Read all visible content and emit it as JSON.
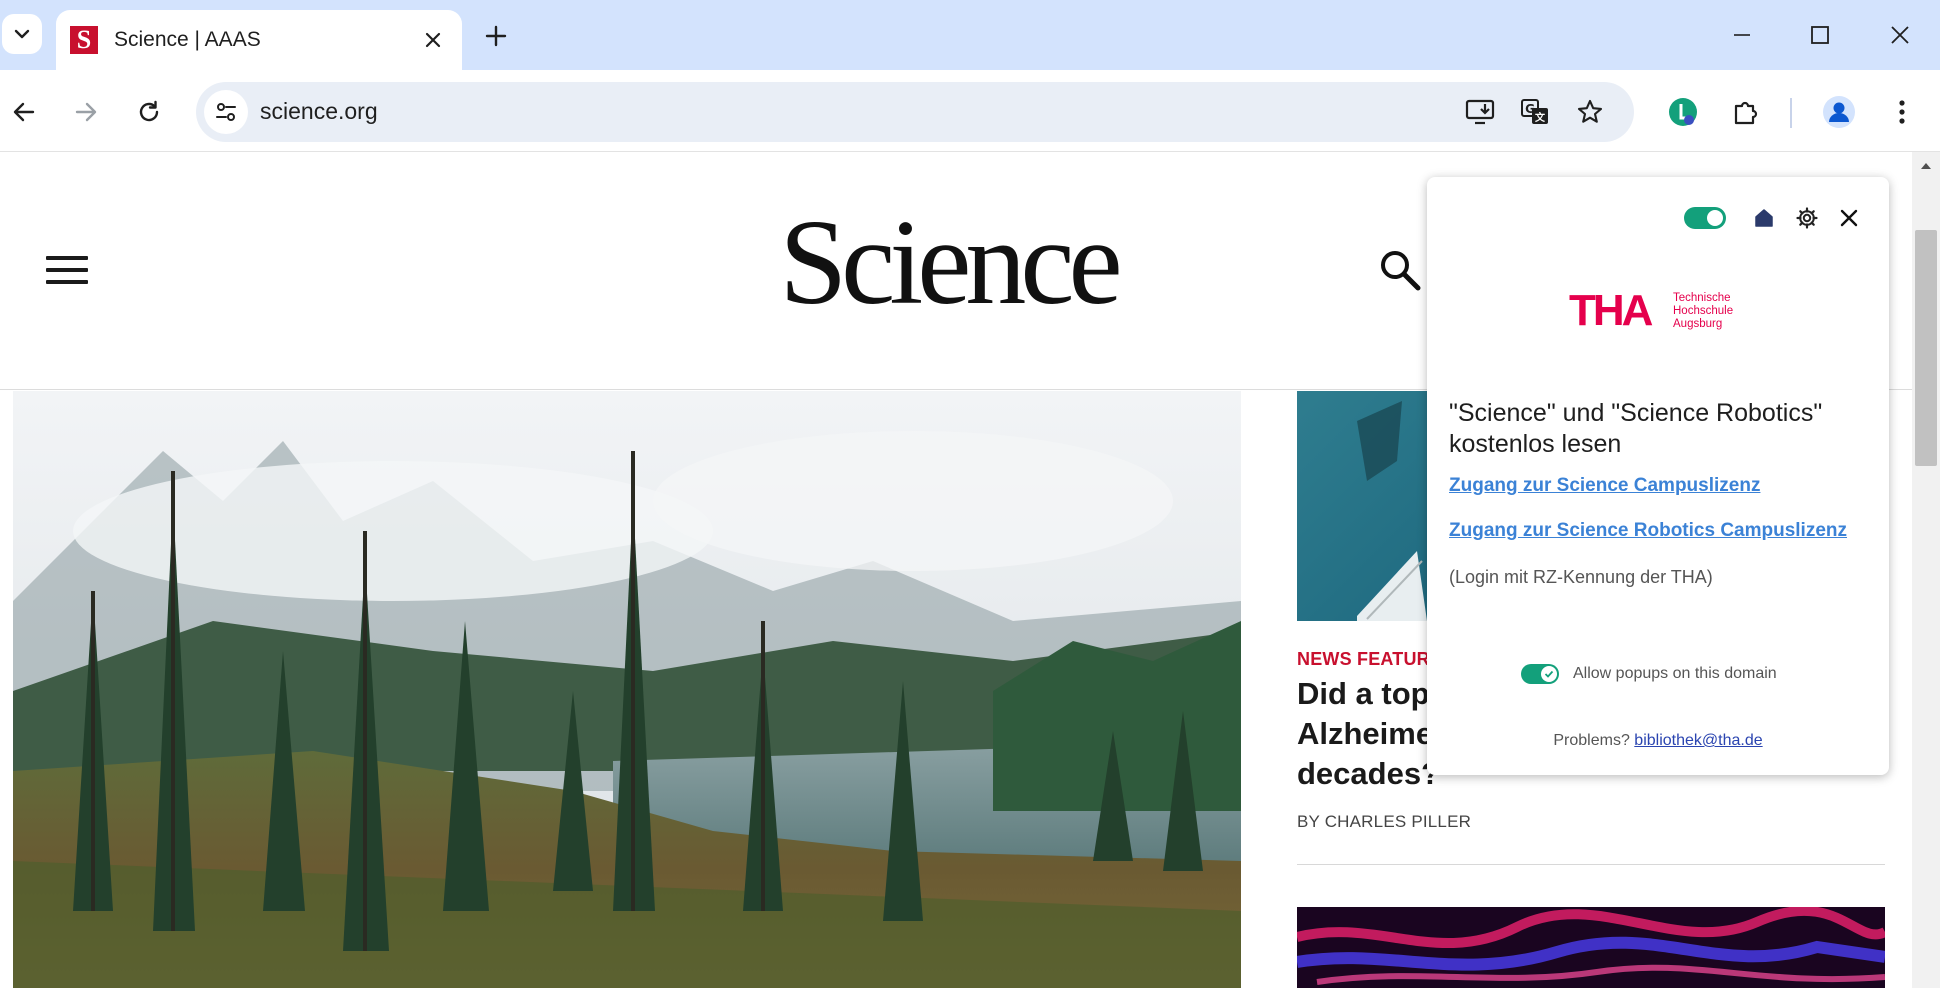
{
  "browser": {
    "tab": {
      "title": "Science | AAAS",
      "favicon_letter": "S"
    },
    "url": "science.org",
    "colors": {
      "tabstrip": "#d3e3fd",
      "omnibox": "#e9eef6",
      "favicon": "#c8102e"
    }
  },
  "site": {
    "brand": "Science",
    "icons": {
      "menu": "hamburger-menu-icon",
      "search": "search-icon"
    }
  },
  "article": {
    "kicker": "NEWS FEATURE",
    "headline_lines": [
      "Did a top",
      "Alzheime",
      "decades?"
    ],
    "byline": "BY CHARLES PILLER"
  },
  "popup": {
    "logo": {
      "mark": "THA",
      "line1": "Technische",
      "line2": "Hochschule",
      "line3": "Augsburg"
    },
    "title": "\"Science\" und \"Science Robotics\" kostenlos lesen",
    "link1": "Zugang zur Science Campuslizenz",
    "link2": "Zugang zur Science Robotics Campuslizenz",
    "note": "(Login mit RZ-Kennung der THA)",
    "allow_label": "Allow popups on this domain",
    "problems_prefix": "Problems?",
    "email": "bibliothek@tha.de",
    "colors": {
      "accent": "#13a07b",
      "link": "#3b82d6",
      "logo": "#e5004c"
    }
  }
}
